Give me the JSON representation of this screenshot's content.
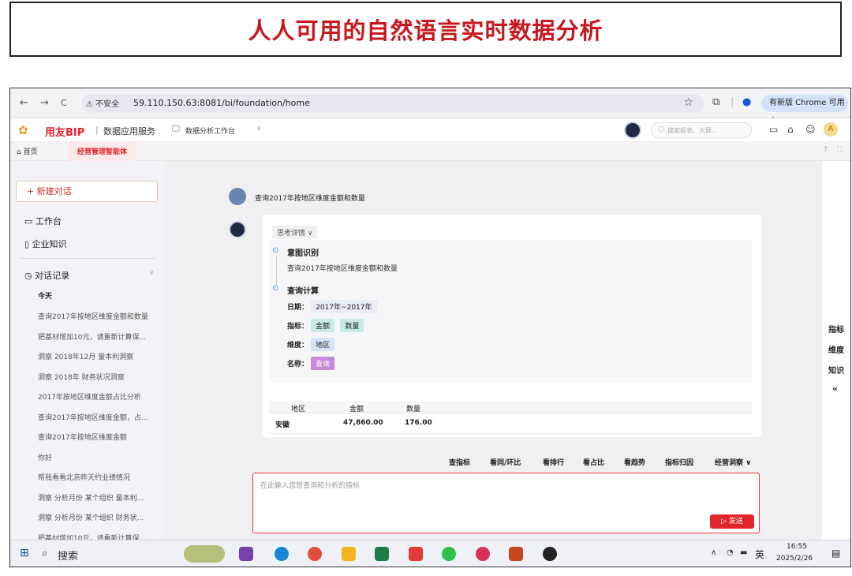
{
  "slide_title": "人人可用的自然语言实时数据分析",
  "browser": {
    "back": "←",
    "forward": "→",
    "reload": "C",
    "not_secure": "⚠ 不安全",
    "url": "59.110.150.63:8081/bi/foundation/home",
    "update_label": "有新版 Chrome 可用 ⋮"
  },
  "app": {
    "brand": "用友BIP",
    "sep": "|",
    "subtitle": "数据应用服务",
    "workbench": "数据分析工作台",
    "search_placeholder": "搜索报表、大屏..."
  },
  "tabs": {
    "home": "首页",
    "active": "经营管理智能体"
  },
  "sidebar": {
    "new_chat": "+ 新建对话",
    "workbench": "工作台",
    "knowledge": "企业知识",
    "history_title": "对话记录",
    "today": "今天",
    "history": [
      "查询2017年按地区维度金额和数量",
      "把基材增加10元，请重新计算保...",
      "洞察 2018年12月 量本利洞察",
      "洞察 2018年 财务状况洞察",
      "2017年按地区维度金额占比分析",
      "查询2017年按地区维度金额，占...",
      "查询2017年按地区维度金额",
      "你好",
      "帮我看看北京昨天约业绩情况",
      "洞察 分析月份 某个组织 量本利...",
      "洞察 分析月份 某个组织 财务状...",
      "把基材增加10元，请重新计算保..."
    ]
  },
  "chat": {
    "user_query": "查询2017年按地区维度金额和数量",
    "think_label": "思考详情 ∨",
    "step1_title": "意图识别",
    "step1_text": "查询2017年按地区维度金额和数量",
    "step2_title": "查询计算",
    "date_label": "日期：",
    "date_value": "2017年~2017年",
    "metric_label": "指标：",
    "metric_1": "金额",
    "metric_2": "数量",
    "dimension_label": "维度：",
    "dimension_value": "地区",
    "name_label": "名称：",
    "name_value": "查询",
    "table_headers": [
      "地区",
      "金额",
      "数量"
    ],
    "table_row": [
      "安徽",
      "47,860.00",
      "176.00"
    ]
  },
  "quick_actions": [
    "查指标",
    "看同/环比",
    "看排行",
    "看占比",
    "看趋势",
    "指标归因",
    "经营洞察 ∨"
  ],
  "input_placeholder": "在此输入您想查询和分析的指标",
  "send_label": "▷ 发送",
  "right_panel": [
    "指标",
    "维度",
    "知识",
    "«"
  ],
  "taskbar": {
    "search": "搜索",
    "ime": "英",
    "time": "16:55",
    "date": "2025/2/26"
  },
  "colors": {
    "brand_red": "#e3262b",
    "title_red": "#c8171e"
  }
}
